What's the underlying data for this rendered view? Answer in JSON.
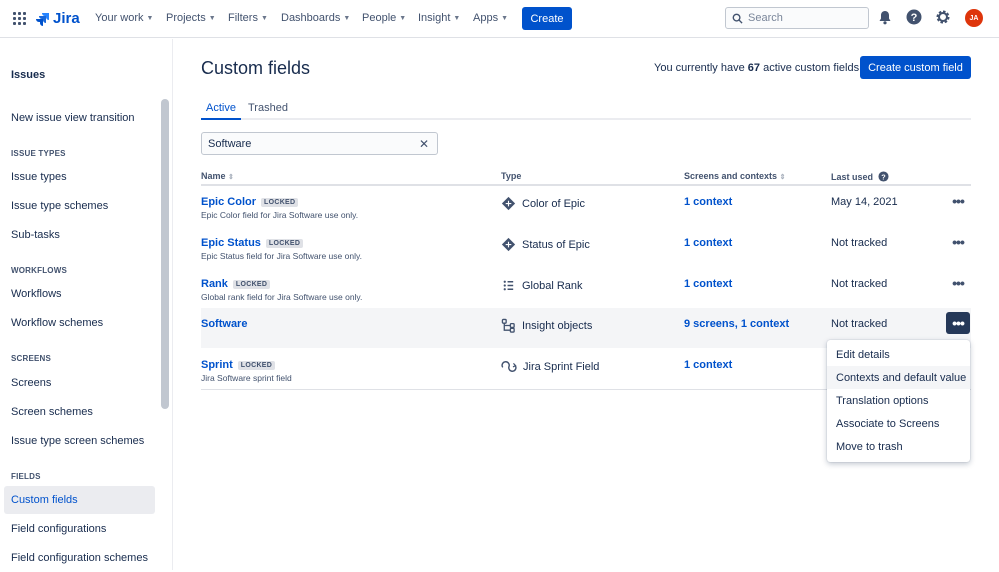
{
  "app": {
    "name": "Jira"
  },
  "topnav": {
    "items": [
      "Your work",
      "Projects",
      "Filters",
      "Dashboards",
      "People",
      "Insight",
      "Apps"
    ],
    "create_label": "Create",
    "search_placeholder": "Search",
    "avatar_initials": "JA"
  },
  "sidebar": {
    "title": "Issues",
    "top_item": "New issue view transition",
    "sections": [
      {
        "heading": "ISSUE TYPES",
        "items": [
          "Issue types",
          "Issue type schemes",
          "Sub-tasks"
        ]
      },
      {
        "heading": "WORKFLOWS",
        "items": [
          "Workflows",
          "Workflow schemes"
        ]
      },
      {
        "heading": "SCREENS",
        "items": [
          "Screens",
          "Screen schemes",
          "Issue type screen schemes"
        ]
      },
      {
        "heading": "FIELDS",
        "items": [
          "Custom fields",
          "Field configurations",
          "Field configuration schemes"
        ]
      }
    ]
  },
  "main": {
    "title": "Custom fields",
    "summary_prefix": "You currently have",
    "summary_count": "67",
    "summary_suffix": "active custom fields",
    "create_button": "Create custom field",
    "tabs": [
      "Active",
      "Trashed"
    ],
    "filter_value": "Software",
    "columns": {
      "name": "Name",
      "type": "Type",
      "screens": "Screens and contexts",
      "last_used": "Last used"
    },
    "rows": [
      {
        "name": "Epic Color",
        "locked": "LOCKED",
        "desc": "Epic Color field for Jira Software use only.",
        "type": "Color of Epic",
        "contexts": "1 context",
        "last_used": "May 14, 2021"
      },
      {
        "name": "Epic Status",
        "locked": "LOCKED",
        "desc": "Epic Status field for Jira Software use only.",
        "type": "Status of Epic",
        "contexts": "1 context",
        "last_used": "Not tracked"
      },
      {
        "name": "Rank",
        "locked": "LOCKED",
        "desc": "Global rank field for Jira Software use only.",
        "type": "Global Rank",
        "contexts": "1 context",
        "last_used": "Not tracked"
      },
      {
        "name": "Software",
        "locked": "",
        "desc": "",
        "type": "Insight objects",
        "contexts": "9 screens, 1 context",
        "last_used": "Not tracked"
      },
      {
        "name": "Sprint",
        "locked": "LOCKED",
        "desc": "Jira Software sprint field",
        "type": "Jira Sprint Field",
        "contexts": "1 context",
        "last_used": ""
      }
    ],
    "menu": [
      "Edit details",
      "Contexts and default value",
      "Translation options",
      "Associate to Screens",
      "Move to trash"
    ]
  },
  "colors": {
    "brand": "#0052CC",
    "text": "#172B4D",
    "avatar": "#DE350B"
  }
}
